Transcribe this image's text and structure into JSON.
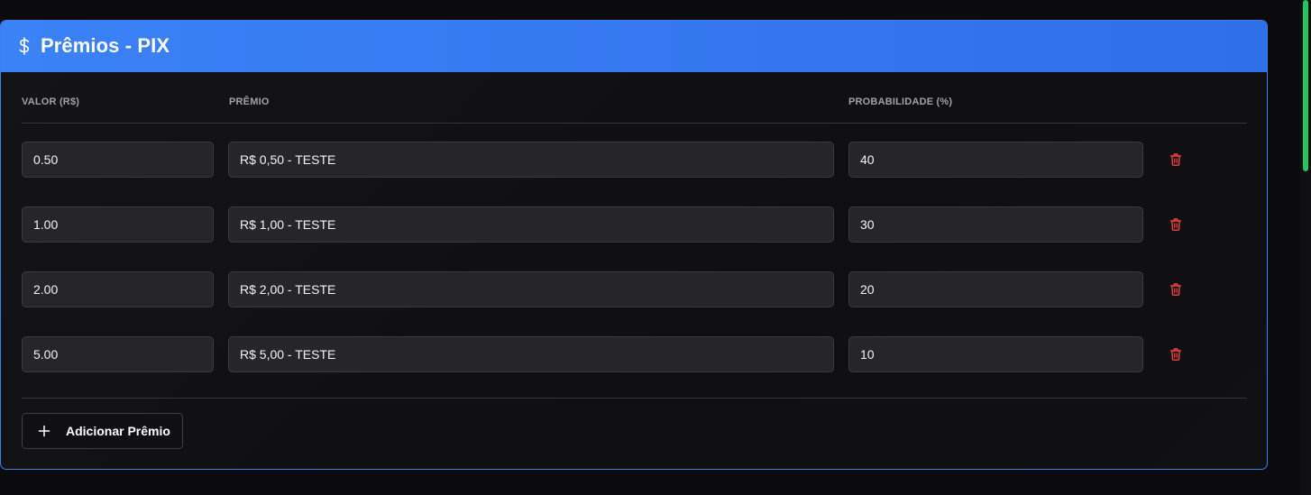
{
  "card": {
    "title": "Prêmios - PIX",
    "icon": "dollar-icon",
    "accent_color": "#3b82f6"
  },
  "columns": {
    "valor": "VALOR (R$)",
    "premio": "PRÊMIO",
    "probabilidade": "PROBABILIDADE (%)"
  },
  "rows": [
    {
      "valor": "0.50",
      "premio": "R$ 0,50 - TESTE",
      "probabilidade": "40"
    },
    {
      "valor": "1.00",
      "premio": "R$ 1,00 - TESTE",
      "probabilidade": "30"
    },
    {
      "valor": "2.00",
      "premio": "R$ 2,00 - TESTE",
      "probabilidade": "20"
    },
    {
      "valor": "5.00",
      "premio": "R$ 5,00 - TESTE",
      "probabilidade": "10"
    }
  ],
  "actions": {
    "add_label": "Adicionar Prêmio",
    "delete_icon": "trash-icon",
    "delete_color": "#ef4444"
  }
}
